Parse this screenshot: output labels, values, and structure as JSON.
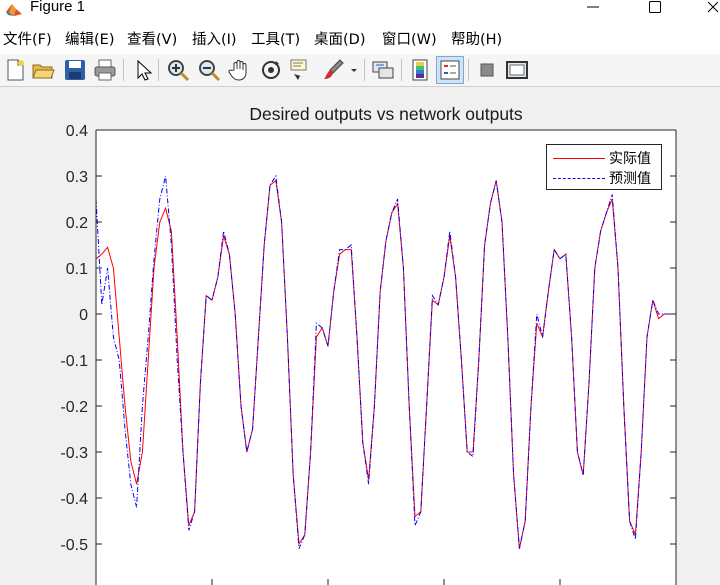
{
  "window": {
    "title": "Figure 1",
    "controls": {
      "minimize": "—",
      "maximize": "☐",
      "close": "✕"
    }
  },
  "menu": {
    "items": [
      "文件(F)",
      "编辑(E)",
      "查看(V)",
      "插入(I)",
      "工具(T)",
      "桌面(D)",
      "窗口(W)",
      "帮助(H)"
    ]
  },
  "toolbar": {
    "buttons": [
      "new-figure-icon",
      "open-file-icon",
      "save-icon",
      "print-icon",
      "edit-plot-arrow-icon",
      "zoom-in-icon",
      "zoom-out-icon",
      "pan-hand-icon",
      "rotate-3d-icon",
      "data-cursor-icon",
      "brush-icon",
      "brush-dropdown-icon",
      "link-plot-icon",
      "insert-colorbar-icon",
      "insert-legend-icon",
      "hide-plot-tools-icon",
      "show-plot-tools-icon"
    ],
    "pressed": "insert-legend-icon"
  },
  "colors": {
    "actual": "#ff0000",
    "predicted": "#0000ff",
    "axes": "#262626",
    "background": "#f0f0f0",
    "plot_bg": "#ffffff"
  },
  "chart_data": {
    "type": "line",
    "title": "Desired outputs vs network outputs",
    "xlabel": "",
    "ylabel": "",
    "ylim": [
      -0.6,
      0.4
    ],
    "yticks": [
      "0.4",
      "0.3",
      "0.2",
      "0.1",
      "0",
      "-0.1",
      "-0.2",
      "-0.3",
      "-0.4",
      "-0.5"
    ],
    "xlim": [
      0,
      100
    ],
    "grid": false,
    "legend_position": "top-right",
    "series": [
      {
        "name": "实际值",
        "color": "#ff0000",
        "style": "solid",
        "x": [
          0,
          1,
          2,
          3,
          4,
          5,
          6,
          7,
          8,
          9,
          10,
          11,
          12,
          13,
          14,
          15,
          16,
          17,
          18,
          19,
          20,
          21,
          22,
          23,
          24,
          25,
          26,
          27,
          28,
          29,
          30,
          31,
          32,
          33,
          34,
          35,
          36,
          37,
          38,
          39,
          40,
          41,
          42,
          43,
          44,
          45,
          46,
          47,
          48,
          49,
          50,
          51,
          52,
          53,
          54,
          55,
          56,
          57,
          58,
          59,
          60,
          61,
          62,
          63,
          64,
          65,
          66,
          67,
          68,
          69,
          70,
          71,
          72,
          73,
          74,
          75,
          76,
          77,
          78,
          79,
          80,
          81,
          82,
          83,
          84,
          85,
          86,
          87,
          88,
          89,
          90,
          91,
          92,
          93,
          94,
          95,
          96,
          97,
          98,
          99,
          100
        ],
        "y": [
          0.12,
          0.13,
          0.145,
          0.1,
          -0.05,
          -0.2,
          -0.32,
          -0.37,
          -0.3,
          -0.1,
          0.1,
          0.2,
          0.23,
          0.18,
          -0.05,
          -0.3,
          -0.46,
          -0.43,
          -0.15,
          0.04,
          0.03,
          0.08,
          0.17,
          0.13,
          0.0,
          -0.2,
          -0.3,
          -0.25,
          -0.05,
          0.15,
          0.28,
          0.29,
          0.2,
          -0.05,
          -0.35,
          -0.5,
          -0.48,
          -0.3,
          -0.05,
          -0.03,
          -0.07,
          0.05,
          0.13,
          0.14,
          0.14,
          -0.05,
          -0.28,
          -0.36,
          -0.2,
          0.05,
          0.16,
          0.22,
          0.24,
          0.1,
          -0.2,
          -0.44,
          -0.43,
          -0.2,
          0.03,
          0.02,
          0.08,
          0.17,
          0.08,
          -0.1,
          -0.3,
          -0.3,
          -0.1,
          0.15,
          0.24,
          0.29,
          0.2,
          -0.05,
          -0.35,
          -0.51,
          -0.45,
          -0.2,
          -0.02,
          -0.05,
          0.05,
          0.14,
          0.12,
          0.13,
          -0.05,
          -0.3,
          -0.35,
          -0.15,
          0.1,
          0.18,
          0.22,
          0.25,
          0.1,
          -0.2,
          -0.45,
          -0.48,
          -0.3,
          -0.05,
          0.03,
          -0.01,
          0.0,
          0.0,
          0.0
        ]
      },
      {
        "name": "预测值",
        "color": "#0000ff",
        "style": "dash-dot",
        "x": [
          0,
          1,
          2,
          3,
          4,
          5,
          6,
          7,
          8,
          9,
          10,
          11,
          12,
          13,
          14,
          15,
          16,
          17,
          18,
          19,
          20,
          21,
          22,
          23,
          24,
          25,
          26,
          27,
          28,
          29,
          30,
          31,
          32,
          33,
          34,
          35,
          36,
          37,
          38,
          39,
          40,
          41,
          42,
          43,
          44,
          45,
          46,
          47,
          48,
          49,
          50,
          51,
          52,
          53,
          54,
          55,
          56,
          57,
          58,
          59,
          60,
          61,
          62,
          63,
          64,
          65,
          66,
          67,
          68,
          69,
          70,
          71,
          72,
          73,
          74,
          75,
          76,
          77,
          78,
          79,
          80,
          81,
          82,
          83,
          84,
          85,
          86,
          87,
          88,
          89,
          90,
          91,
          92,
          93,
          94,
          95,
          96,
          97,
          98,
          99,
          100
        ],
        "y": [
          0.25,
          0.02,
          0.1,
          -0.05,
          -0.1,
          -0.25,
          -0.37,
          -0.42,
          -0.2,
          -0.05,
          0.12,
          0.25,
          0.3,
          0.15,
          -0.1,
          -0.3,
          -0.47,
          -0.43,
          -0.15,
          0.04,
          0.03,
          0.08,
          0.18,
          0.13,
          0.0,
          -0.2,
          -0.3,
          -0.25,
          -0.05,
          0.15,
          0.28,
          0.3,
          0.2,
          -0.05,
          -0.35,
          -0.51,
          -0.48,
          -0.3,
          -0.02,
          -0.03,
          -0.07,
          0.05,
          0.14,
          0.14,
          0.15,
          -0.05,
          -0.28,
          -0.37,
          -0.2,
          0.05,
          0.16,
          0.22,
          0.25,
          0.1,
          -0.2,
          -0.46,
          -0.43,
          -0.2,
          0.04,
          0.02,
          0.08,
          0.18,
          0.08,
          -0.1,
          -0.3,
          -0.31,
          -0.1,
          0.15,
          0.24,
          0.29,
          0.2,
          -0.05,
          -0.35,
          -0.51,
          -0.45,
          -0.2,
          0.0,
          -0.05,
          0.05,
          0.14,
          0.12,
          0.13,
          -0.05,
          -0.3,
          -0.35,
          -0.15,
          0.1,
          0.18,
          0.22,
          0.26,
          0.1,
          -0.2,
          -0.45,
          -0.49,
          -0.3,
          -0.05,
          0.03,
          0.0,
          0.0,
          0.0,
          0.0
        ]
      }
    ]
  }
}
